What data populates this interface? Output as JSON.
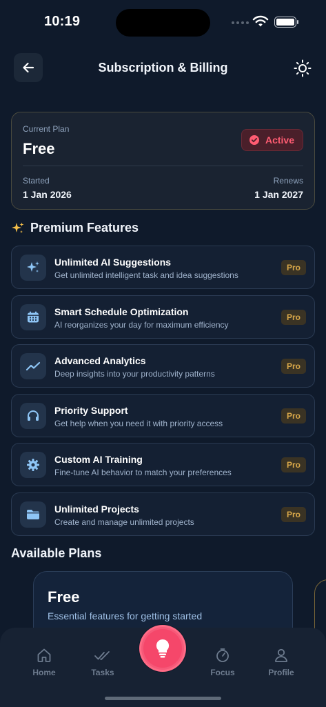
{
  "status_bar": {
    "time": "10:19"
  },
  "header": {
    "title": "Subscription & Billing"
  },
  "current_plan": {
    "label": "Current Plan",
    "name": "Free",
    "status": "Active",
    "started_label": "Started",
    "started_value": "1 Jan 2026",
    "renews_label": "Renews",
    "renews_value": "1 Jan 2027"
  },
  "premium": {
    "title": "Premium Features",
    "features": [
      {
        "title": "Unlimited AI Suggestions",
        "desc": "Get unlimited intelligent task and idea suggestions",
        "badge": "Pro",
        "icon": "sparkles-icon"
      },
      {
        "title": "Smart Schedule Optimization",
        "desc": "AI reorganizes your day for maximum efficiency",
        "badge": "Pro",
        "icon": "calendar-icon"
      },
      {
        "title": "Advanced Analytics",
        "desc": "Deep insights into your productivity patterns",
        "badge": "Pro",
        "icon": "trend-chart-icon"
      },
      {
        "title": "Priority Support",
        "desc": "Get help when you need it with priority access",
        "badge": "Pro",
        "icon": "headphones-icon"
      },
      {
        "title": "Custom AI Training",
        "desc": "Fine-tune AI behavior to match your preferences",
        "badge": "Pro",
        "icon": "gear-icon"
      },
      {
        "title": "Unlimited Projects",
        "desc": "Create and manage unlimited projects",
        "badge": "Pro",
        "icon": "folder-icon"
      }
    ]
  },
  "plans": {
    "title": "Available Plans",
    "items": [
      {
        "name": "Free",
        "desc": "Essential features for getting started"
      }
    ]
  },
  "nav": {
    "items": [
      {
        "label": "Home",
        "icon": "home-icon"
      },
      {
        "label": "Tasks",
        "icon": "double-check-icon"
      },
      {
        "label": "Focus",
        "icon": "timer-icon"
      },
      {
        "label": "Profile",
        "icon": "user-icon"
      }
    ],
    "fab_icon": "lightbulb-icon"
  },
  "colors": {
    "background": "#0f1a2b",
    "accent": "#f5476a",
    "active": "#ff5c72",
    "pro": "#d9a84a",
    "icon_blue": "#8ec5f5"
  }
}
